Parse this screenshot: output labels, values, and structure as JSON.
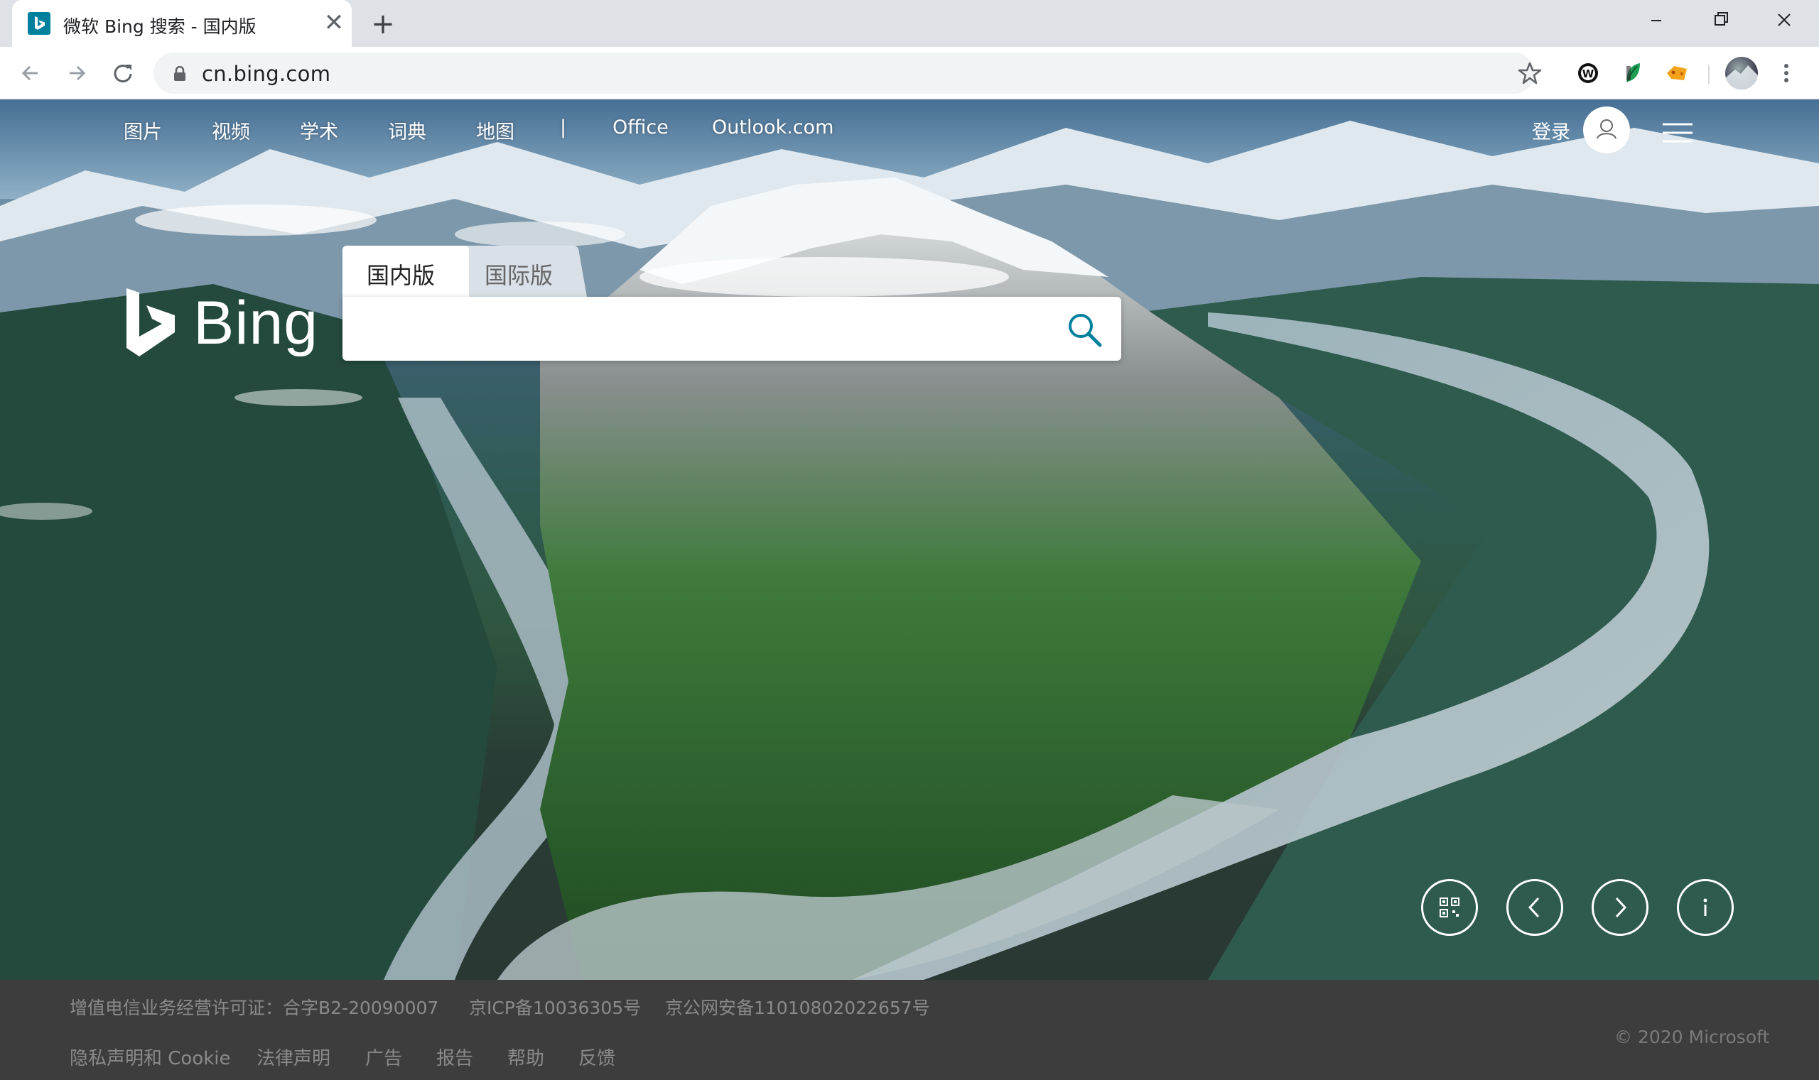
{
  "browser": {
    "tab_title": "微软 Bing 搜索 - 国内版",
    "tab_close_glyph": "✕",
    "new_tab_glyph": "+",
    "url": "cn.bing.com",
    "icons": [
      "bing-favicon",
      "back-arrow",
      "forward-arrow",
      "reload",
      "lock",
      "bookmark-star",
      "w-extension",
      "leaf-extension",
      "tag-extension",
      "profile-avatar",
      "more-vertical",
      "minimize",
      "restore",
      "close"
    ]
  },
  "page": {
    "topnav": [
      "图片",
      "视频",
      "学术",
      "词典",
      "地图",
      "|",
      "Office",
      "Outlook.com"
    ],
    "login_label": "登录",
    "logo_text": "Bing",
    "search_tabs": {
      "active": "国内版",
      "inactive": "国际版"
    },
    "search_placeholder": "",
    "action_icons": [
      "qr-code-icon",
      "previous-image-icon",
      "next-image-icon",
      "info-icon"
    ],
    "accent_color": "#00809d"
  },
  "footer": {
    "row1": [
      "增值电信业务经营许可证：合字B2-20090007",
      "京ICP备10036305号",
      "京公网安备11010802022657号"
    ],
    "row2": [
      "隐私声明和 Cookie",
      "法律声明",
      "广告",
      "报告",
      "帮助",
      "反馈"
    ],
    "copyright": "© 2020 Microsoft"
  }
}
